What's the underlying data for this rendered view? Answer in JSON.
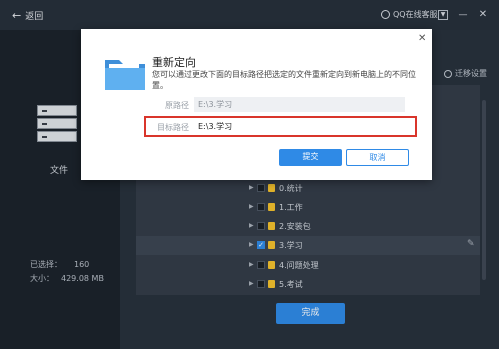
{
  "topbar": {
    "back_label": "返回",
    "support_label": "QQ在线客服"
  },
  "left": {
    "file_label": "文件",
    "selected_label": "已选择：",
    "selected_value": "160",
    "size_label": "大小：",
    "size_value": "429.08 MB"
  },
  "right": {
    "migrate_label": "迁移设置",
    "rows": [
      {
        "name": "0.统计",
        "checked": false
      },
      {
        "name": "1.工作",
        "checked": false
      },
      {
        "name": "2.安装包",
        "checked": false
      },
      {
        "name": "3.学习",
        "checked": true
      },
      {
        "name": "4.问题处理",
        "checked": false
      },
      {
        "name": "5.考试",
        "checked": false
      }
    ],
    "done_label": "完成"
  },
  "dialog": {
    "title": "重新定向",
    "description": "您可以通过更改下面的目标路径把选定的文件重新定向到新电脑上的不同位置。",
    "original_path_label": "原路径",
    "original_path_value": "E:\\3.学习",
    "target_path_label": "目标路径",
    "target_path_value": "E:\\3.学习",
    "submit_label": "提交",
    "cancel_label": "取消"
  },
  "colors": {
    "accent": "#2f8ae6",
    "highlight": "#d9352b",
    "folder": "#f2c12e"
  }
}
